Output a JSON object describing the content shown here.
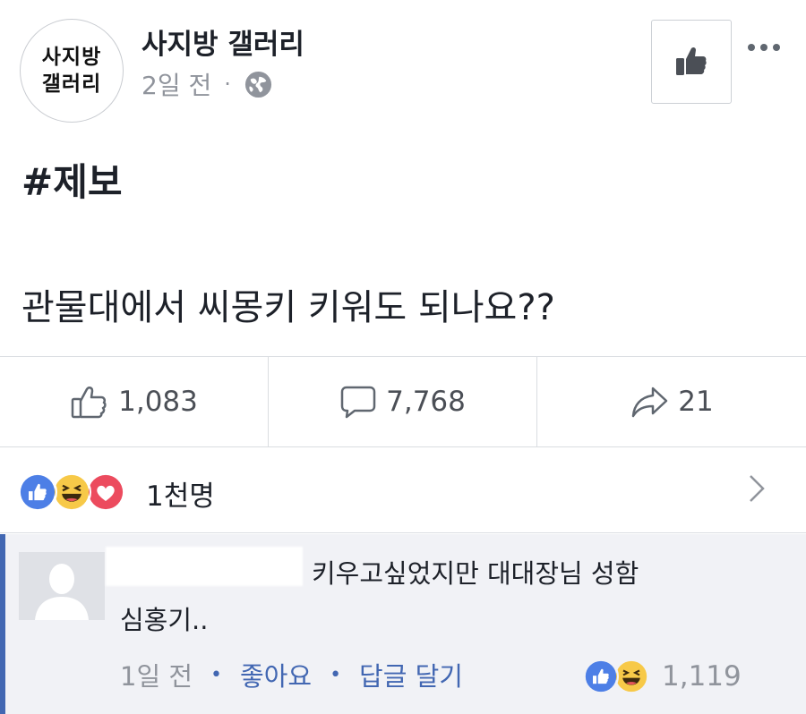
{
  "post": {
    "page_name": "사지방 갤러리",
    "avatar_line1": "사지방",
    "avatar_line2": "갤러리",
    "time": "2일 전",
    "meta_separator": "·",
    "hashtag": "#제보",
    "text": "관물대에서 씨몽키 키워도 되나요??"
  },
  "actions": {
    "like_count": "1,083",
    "comment_count": "7,768",
    "share_count": "21"
  },
  "reactions": {
    "count": "1천명",
    "icons": [
      "like-reaction-icon",
      "haha-reaction-icon",
      "love-reaction-icon"
    ],
    "colors": {
      "like": "#4d7fe6",
      "haha": "#f7c948",
      "love": "#ec4b5e"
    }
  },
  "comment": {
    "text_line1": "키우고싶었지만 대대장님 성함",
    "text_line2": "심홍기..",
    "time": "1일 전",
    "separator": "•",
    "like_label": "좋아요",
    "reply_label": "답글 달기",
    "reaction_count": "1,119",
    "accent_color": "#4267b2"
  }
}
